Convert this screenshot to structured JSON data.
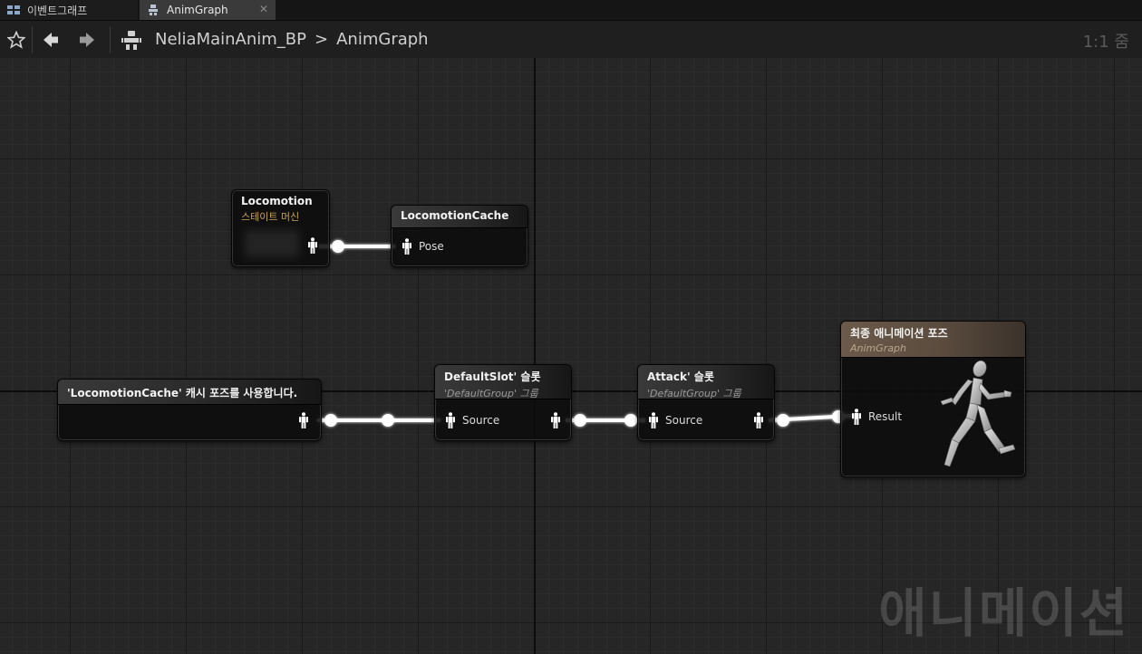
{
  "tabs": [
    {
      "label": "이벤트그래프",
      "icon": "event-graph-icon"
    },
    {
      "label": "AnimGraph",
      "icon": "anim-graph-icon"
    }
  ],
  "toolbar": {
    "breadcrumb": [
      "NeliaMainAnim_BP",
      "AnimGraph"
    ],
    "breadcrumb_separator": ">",
    "zoom": "1:1 줌"
  },
  "nodes": {
    "locomotion": {
      "title": "Locomotion",
      "subtitle": "스테이트 머신"
    },
    "locomotion_cache": {
      "title": "LocomotionCache",
      "pin": "Pose"
    },
    "use_cache": {
      "title": "'LocomotionCache' 캐시 포즈를 사용합니다."
    },
    "default_slot": {
      "title": "DefaultSlot' 슬롯",
      "subtitle": "'DefaultGroup' 그룹",
      "pin": "Source"
    },
    "attack_slot": {
      "title": "Attack' 슬롯",
      "subtitle": "'DefaultGroup' 그룹",
      "pin": "Source"
    },
    "final_pose": {
      "title": "최종 애니메이션 포즈",
      "subtitle": "AnimGraph",
      "pin": "Result"
    }
  },
  "watermark": "애니메이션",
  "colors": {
    "node_header_final": "#6b5a4a",
    "wire": "#ffffff",
    "pin": "#ffffff"
  }
}
